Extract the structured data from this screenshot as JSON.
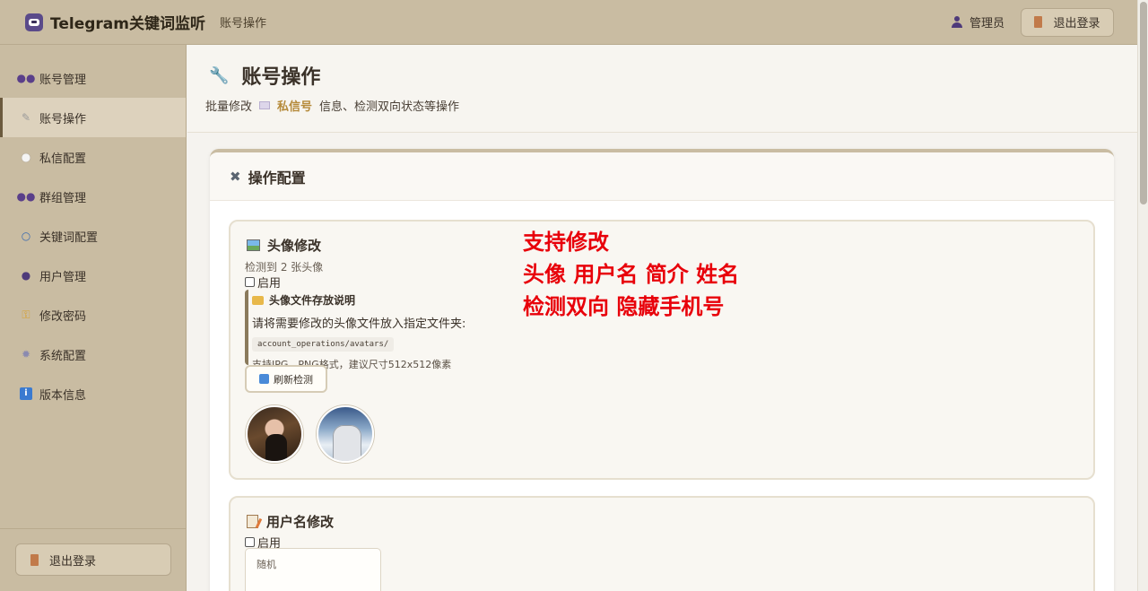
{
  "header": {
    "app_title": "Telegram关键词监听",
    "breadcrumb": "账号操作",
    "user_label": "管理员",
    "logout_label": "退出登录"
  },
  "sidebar": {
    "items": [
      {
        "label": "账号管理",
        "icon": "users-icon"
      },
      {
        "label": "账号操作",
        "icon": "wrench-icon"
      },
      {
        "label": "私信配置",
        "icon": "chat-bubble-icon"
      },
      {
        "label": "群组管理",
        "icon": "group-icon"
      },
      {
        "label": "关键词配置",
        "icon": "search-icon"
      },
      {
        "label": "用户管理",
        "icon": "user-icon"
      },
      {
        "label": "修改密码",
        "icon": "key-icon"
      },
      {
        "label": "系统配置",
        "icon": "gear-icon"
      },
      {
        "label": "版本信息",
        "icon": "info-icon"
      }
    ],
    "active_index": 1,
    "logout_label": "退出登录"
  },
  "page": {
    "title": "账号操作",
    "subtitle_prefix": "批量修改",
    "subtitle_highlight": "私信号",
    "subtitle_suffix": "信息、检测双向状态等操作"
  },
  "config_card": {
    "title": "操作配置"
  },
  "avatar_section": {
    "title": "头像修改",
    "detected": "检测到 2 张头像",
    "enable_label": "启用",
    "info_title": "头像文件存放说明",
    "info_line": "请将需要修改的头像文件放入指定文件夹:",
    "folder_path": "account_operations/avatars/",
    "hint": "支持JPG、PNG格式，建议尺寸512x512像素",
    "refresh_label": "刷新检测"
  },
  "overlay": {
    "line1": "支持修改",
    "line2": "头像 用户名 简介 姓名",
    "line3": "检测双向 隐藏手机号",
    "color": "#e8000a"
  },
  "username_section": {
    "title": "用户名修改",
    "enable_label": "启用",
    "field_value": "随机"
  }
}
